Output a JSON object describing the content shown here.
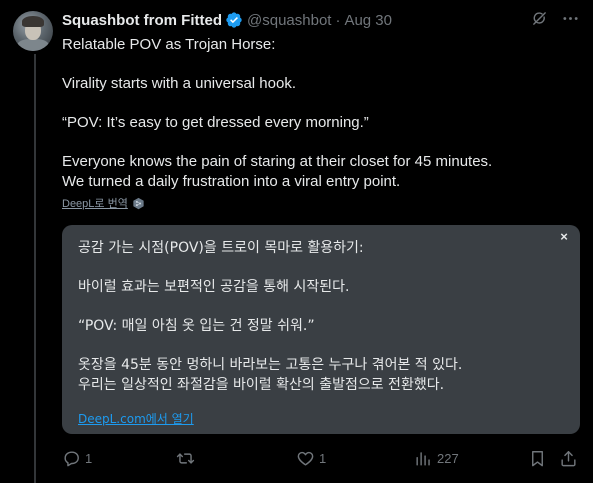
{
  "author": {
    "name": "Squashbot from Fitted",
    "handle": "@squashbot",
    "separator": "·",
    "date": "Aug 30"
  },
  "tweet": {
    "lines": [
      "Relatable POV as Trojan Horse:",
      "",
      "Virality starts with a universal hook.",
      "",
      "“POV: It’s easy to get dressed every morning.”",
      "",
      "Everyone knows the pain of staring at their closet for 45 minutes.",
      "We turned a daily frustration into a viral entry point."
    ]
  },
  "translate": {
    "link_label": "DeepL로 번역"
  },
  "translation": {
    "close_label": "×",
    "lines": [
      "공감 가는 시점(POV)을 트로이 목마로 활용하기:",
      "",
      "바이럴 효과는 보편적인 공감을 통해 시작된다.",
      "",
      "“POV: 매일 아침 옷 입는 건 정말 쉬워.”",
      "",
      "옷장을 45분 동안 멍하니 바라보는 고통은 누구나 겪어본 적 있다.",
      "우리는 일상적인 좌절감을 바이럴 확산의 출발점으로 전환했다."
    ],
    "open_link": "DeepL.com에서 열기"
  },
  "actions": {
    "reply_count": "1",
    "retweet_count": "",
    "like_count": "1",
    "view_count": "227"
  },
  "icons": {
    "verified": "verified-badge-icon",
    "grok": "grok-icon",
    "more": "more-dots-icon",
    "deepl": "deepl-icon",
    "reply": "reply-icon",
    "retweet": "retweet-icon",
    "like": "heart-icon",
    "views": "views-icon",
    "bookmark": "bookmark-icon",
    "share": "share-icon"
  },
  "colors": {
    "background": "#000000",
    "text": "#e7e9ea",
    "secondary": "#71767b",
    "accent": "#1d9bf0",
    "card": "#3a3f44"
  }
}
